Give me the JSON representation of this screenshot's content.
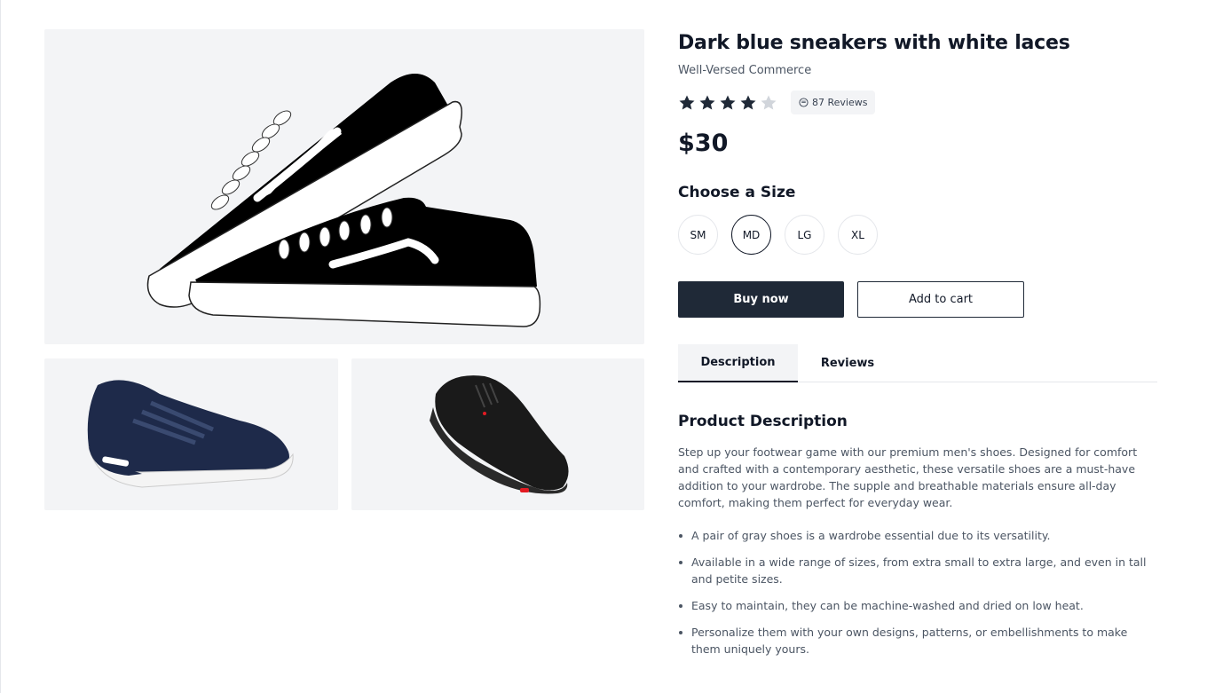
{
  "gallery": {
    "main_image": "black-canvas-sneakers",
    "thumbnails": [
      "navy-running-shoe",
      "black-cycling-shoe"
    ]
  },
  "product": {
    "title": "Dark blue sneakers with white laces",
    "brand": "Well-Versed Commerce",
    "rating": 4,
    "rating_max": 5,
    "reviews_label": "87 Reviews",
    "price": "$30"
  },
  "sizes": {
    "heading": "Choose a Size",
    "options": [
      "SM",
      "MD",
      "LG",
      "XL"
    ],
    "selected": "MD"
  },
  "actions": {
    "buy_label": "Buy now",
    "cart_label": "Add to cart"
  },
  "tabs": [
    {
      "label": "Description",
      "active": true
    },
    {
      "label": "Reviews",
      "active": false
    }
  ],
  "description": {
    "heading": "Product Description",
    "text": "Step up your footwear game with our premium men's shoes. Designed for comfort and crafted with a contemporary aesthetic, these versatile shoes are a must-have addition to your wardrobe. The supple and breathable materials ensure all-day comfort, making them perfect for everyday wear.",
    "bullets": [
      "A pair of gray shoes is a wardrobe essential due to its versatility.",
      "Available in a wide range of sizes, from extra small to extra large, and even in tall and petite sizes.",
      "Easy to maintain, they can be machine-washed and dried on low heat.",
      "Personalize them with your own designs, patterns, or embellishments to make them uniquely yours."
    ]
  },
  "colors": {
    "primary": "#1f2937",
    "star_filled": "#1f2937",
    "star_empty": "#d1d5db",
    "image_bg": "#f3f4f6"
  }
}
